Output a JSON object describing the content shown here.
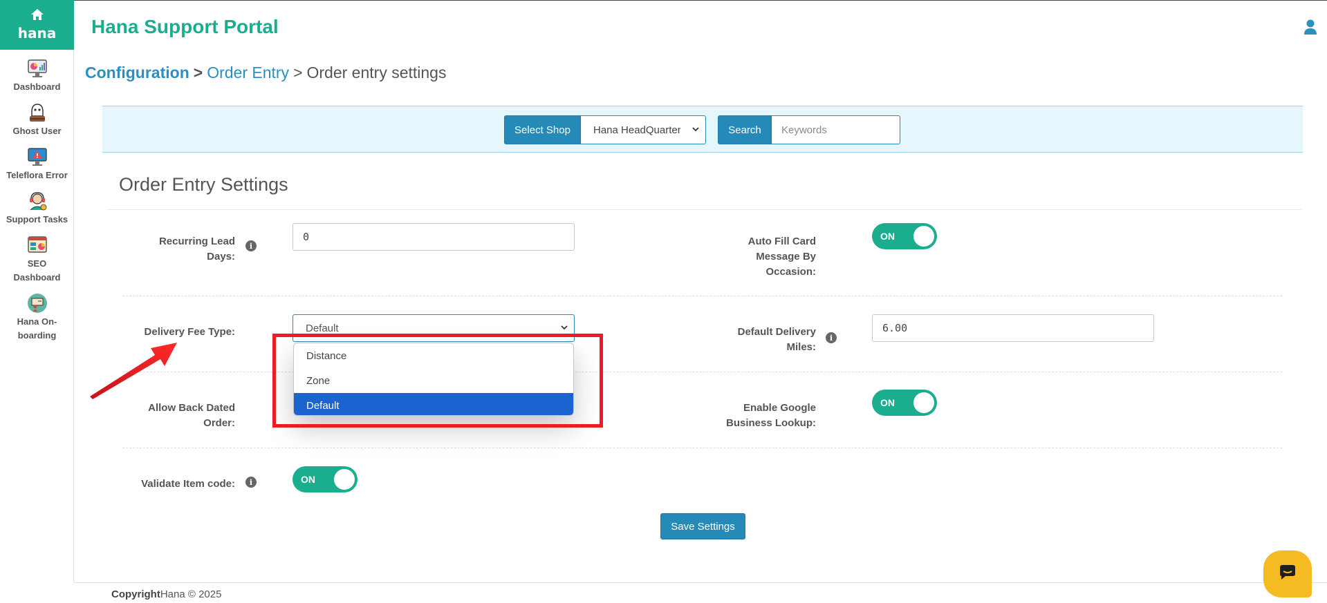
{
  "sidebar": {
    "brand": "hana",
    "items": [
      {
        "label": "Dashboard",
        "icon": "dashboard-chart-icon"
      },
      {
        "label": "Ghost User",
        "icon": "ghost-user-icon"
      },
      {
        "label": "Teleflora Error",
        "icon": "monitor-warning-icon"
      },
      {
        "label": "Support Tasks",
        "icon": "support-agent-icon"
      },
      {
        "label": "SEO Dashboard",
        "icon": "seo-dashboard-icon"
      },
      {
        "label": "Hana On-boarding",
        "icon": "onboarding-icon"
      }
    ]
  },
  "header": {
    "title": "Hana Support Portal"
  },
  "breadcrumb": {
    "root": "Configuration",
    "sep": ">",
    "middle": "Order Entry",
    "current": "Order entry settings"
  },
  "search_bar": {
    "select_shop_label": "Select Shop",
    "shop_value": "Hana HeadQuarter",
    "search_label": "Search",
    "search_placeholder": "Keywords"
  },
  "settings": {
    "title": "Order Entry Settings",
    "recurring_lead_days": {
      "label": "Recurring Lead Days:",
      "value": "0"
    },
    "auto_fill_card": {
      "label": "Auto Fill Card Message By Occasion:",
      "state": "ON"
    },
    "delivery_fee_type": {
      "label": "Delivery Fee Type:",
      "value": "Default",
      "options": [
        "Distance",
        "Zone",
        "Default"
      ],
      "selected": "Default"
    },
    "default_delivery_miles": {
      "label": "Default Delivery Miles:",
      "value": "6.00"
    },
    "allow_back_dated_order": {
      "label": "Allow Back Dated Order:"
    },
    "enable_google_business_lookup": {
      "label": "Enable Google Business Lookup:",
      "state": "ON"
    },
    "validate_item_code": {
      "label": "Validate Item code:",
      "state": "ON"
    },
    "save_label": "Save Settings"
  },
  "footer": {
    "copyright_bold": "Copyright",
    "copyright_rest": "Hana © 2025"
  },
  "colors": {
    "brand_green": "#1aae8f",
    "primary_blue": "#268ab9",
    "highlight_red": "#ec1c24",
    "selected_option": "#1b63d1",
    "chat_yellow": "#f5bb22"
  }
}
